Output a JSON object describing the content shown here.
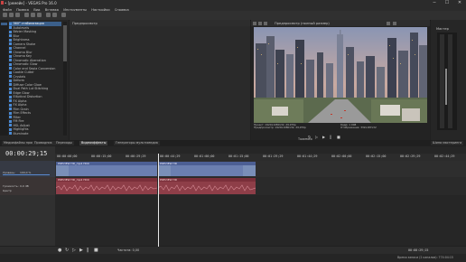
{
  "window": {
    "title": "• [ремейк] - VEGAS Pro 16.0",
    "controls": [
      "─",
      "☐",
      "✕"
    ]
  },
  "menu": [
    "Файл",
    "Правка",
    "Вид",
    "Вставка",
    "Инструменты",
    "Настройки",
    "Справка"
  ],
  "fx_panel": {
    "items": [
      "360° стабилизация",
      "Autolevels",
      "Bézier Masking",
      "Blur",
      "Brightness",
      "Camera Shake",
      "Channel",
      "Chroma Blur",
      "Chroma Key",
      "Chromatic Aberration",
      "Chromatic Glow",
      "Color and Sepia Conversion",
      "Cookie Cutter",
      "Crystals",
      "Deform",
      "Diffuse Color Glow",
      "Dual Path Lut Stitching",
      "Edge Glow",
      "Elliptical Distortion",
      "FX Alpha",
      "FX Alpha",
      "Film Grain",
      "Film Effects",
      "Filter",
      "FM Fire",
      "HSL Adjust",
      "Highlights",
      "Illuminate",
      "Lens Flare",
      "Lens Blur",
      "Light Rays",
      "Linear Blur"
    ],
    "selected_index": 0
  },
  "preview_panel": {
    "header": "Предпросмотр"
  },
  "video_panel": {
    "header": "Предпросмотр (полный размер)",
    "info_left": [
      "Проект: 1920x1080x32, 29,970р",
      "Предпросмотр: 1920x1080x32, 29,970р",
      "Отображение: 332x187x32"
    ],
    "info_right": [
      "Кадр: 1 908",
      "Отображение: 332x187x32"
    ],
    "tab_label": "Триммер"
  },
  "right_panel": {
    "title": "Мастер"
  },
  "tabs": [
    "Медиафайлы проекта",
    "Проводник",
    "Переходы",
    "Видеоэффекты",
    "Генераторы мультимедиа"
  ],
  "right_tab": "Шина мастеринга",
  "timeline": {
    "timecode": "00:00:29;15",
    "ruler_labels": [
      "00:00:00;00",
      "00:00:15;00",
      "00:00:29;29",
      "00:00:44;29",
      "00:01:00;00",
      "00:01:15;00",
      "00:01:29;29",
      "00:01:44;29",
      "00:02:00;00",
      "00:02:15;00",
      "00:02:29;29",
      "00:02:44;29"
    ],
    "video_clips": [
      {
        "label": "PREVIEW HD_mp4 HD0"
      },
      {
        "label": "PREVIEW HD"
      }
    ],
    "audio_clips": [
      {
        "label": "PREVIEW HD_mp4 HD0"
      },
      {
        "label": "PREVIEW HD"
      }
    ],
    "track1_label": "Уровень:",
    "track1_value": "100,0 %",
    "track2_label": "Громкость:",
    "track2_value": "0,0 dB",
    "track2_pan": "Центр"
  },
  "transport": {
    "rate": "Частота: 0,00",
    "position": "00:00:29;15"
  },
  "status": {
    "left": "",
    "right": "Время записи (2 каналов): 774:04:15"
  },
  "colors": {
    "video_clip": "#6b7fb0",
    "audio_clip": "#8e3e48",
    "selection": "#3b5f8a"
  }
}
